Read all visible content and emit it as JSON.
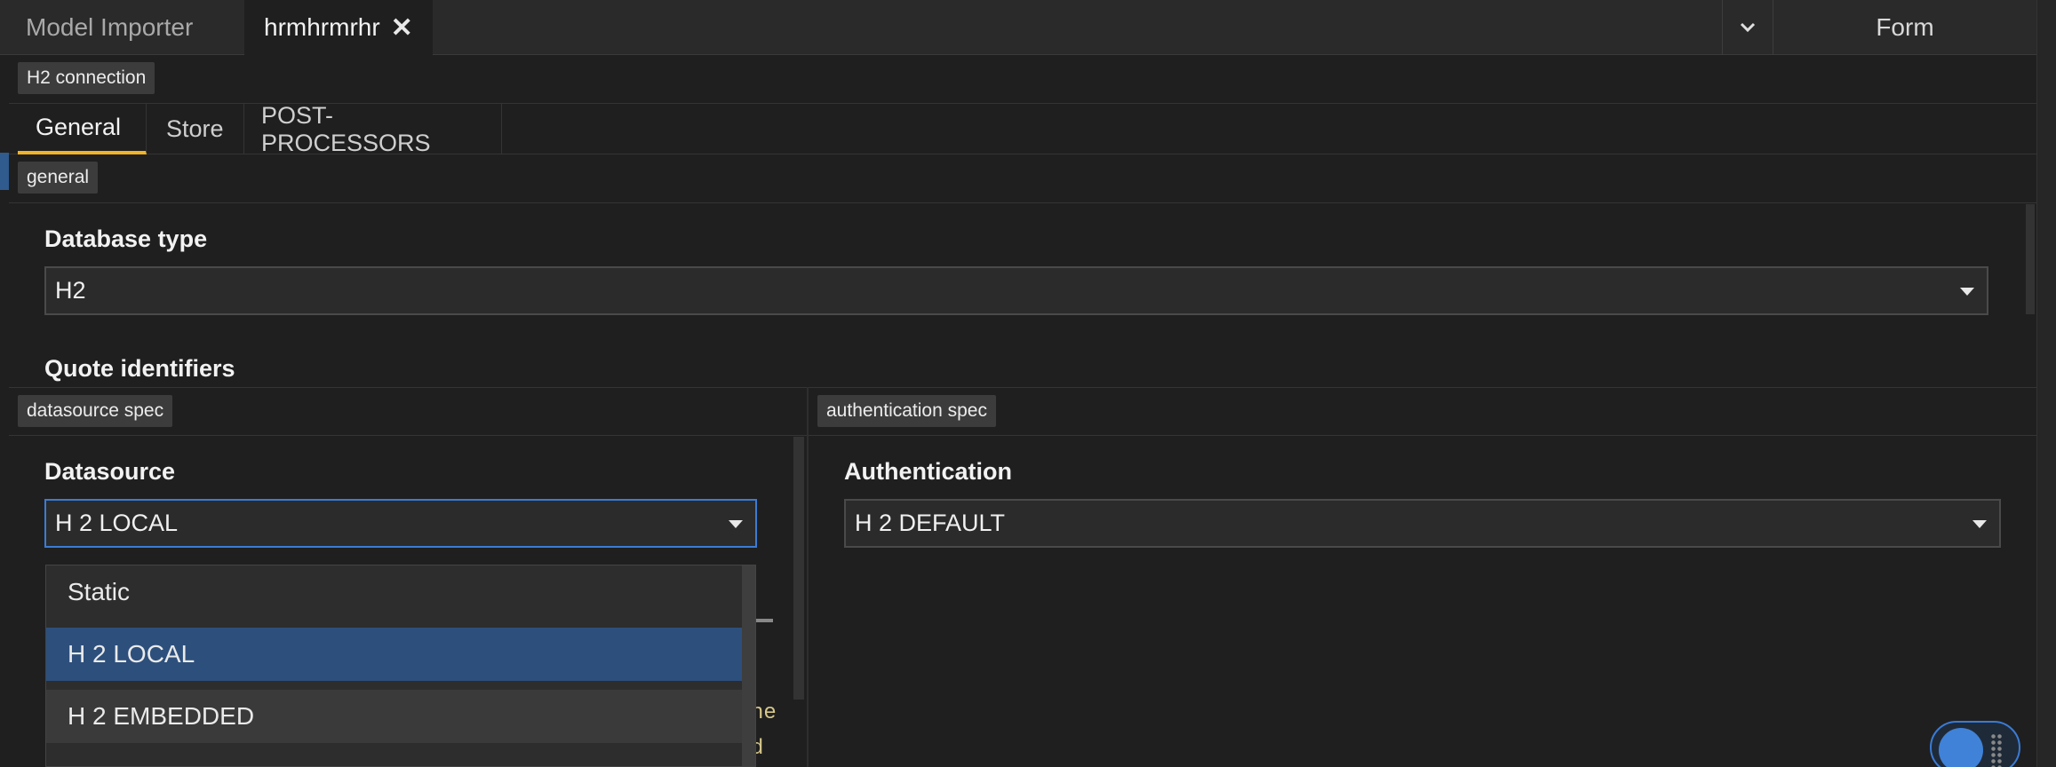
{
  "tabs": {
    "importer": "Model Importer",
    "active": "hrmhrmrhr",
    "close_icon": "close-icon",
    "form": "Form"
  },
  "connection_chip": "H2 connection",
  "subtabs": [
    {
      "label": "General",
      "active": true
    },
    {
      "label": "Store",
      "active": false
    },
    {
      "label": "POST-PROCESSORS",
      "active": false
    }
  ],
  "general_chip": "general",
  "database_type": {
    "label": "Database type",
    "value": "H2"
  },
  "quote_identifiers": {
    "label": "Quote identifiers"
  },
  "datasource_chip": "datasource spec",
  "authentication_chip": "authentication spec",
  "datasource": {
    "label": "Datasource",
    "value": "H 2 LOCAL",
    "options": [
      "Static",
      "H 2 LOCAL",
      "H 2 EMBEDDED"
    ],
    "selected_index": 1,
    "hover_index": 2
  },
  "authentication": {
    "label": "Authentication",
    "value": "H 2 DEFAULT"
  },
  "colors": {
    "accent": "#f0b429",
    "focus": "#3a7bd5",
    "selected": "#2d4f7c"
  }
}
